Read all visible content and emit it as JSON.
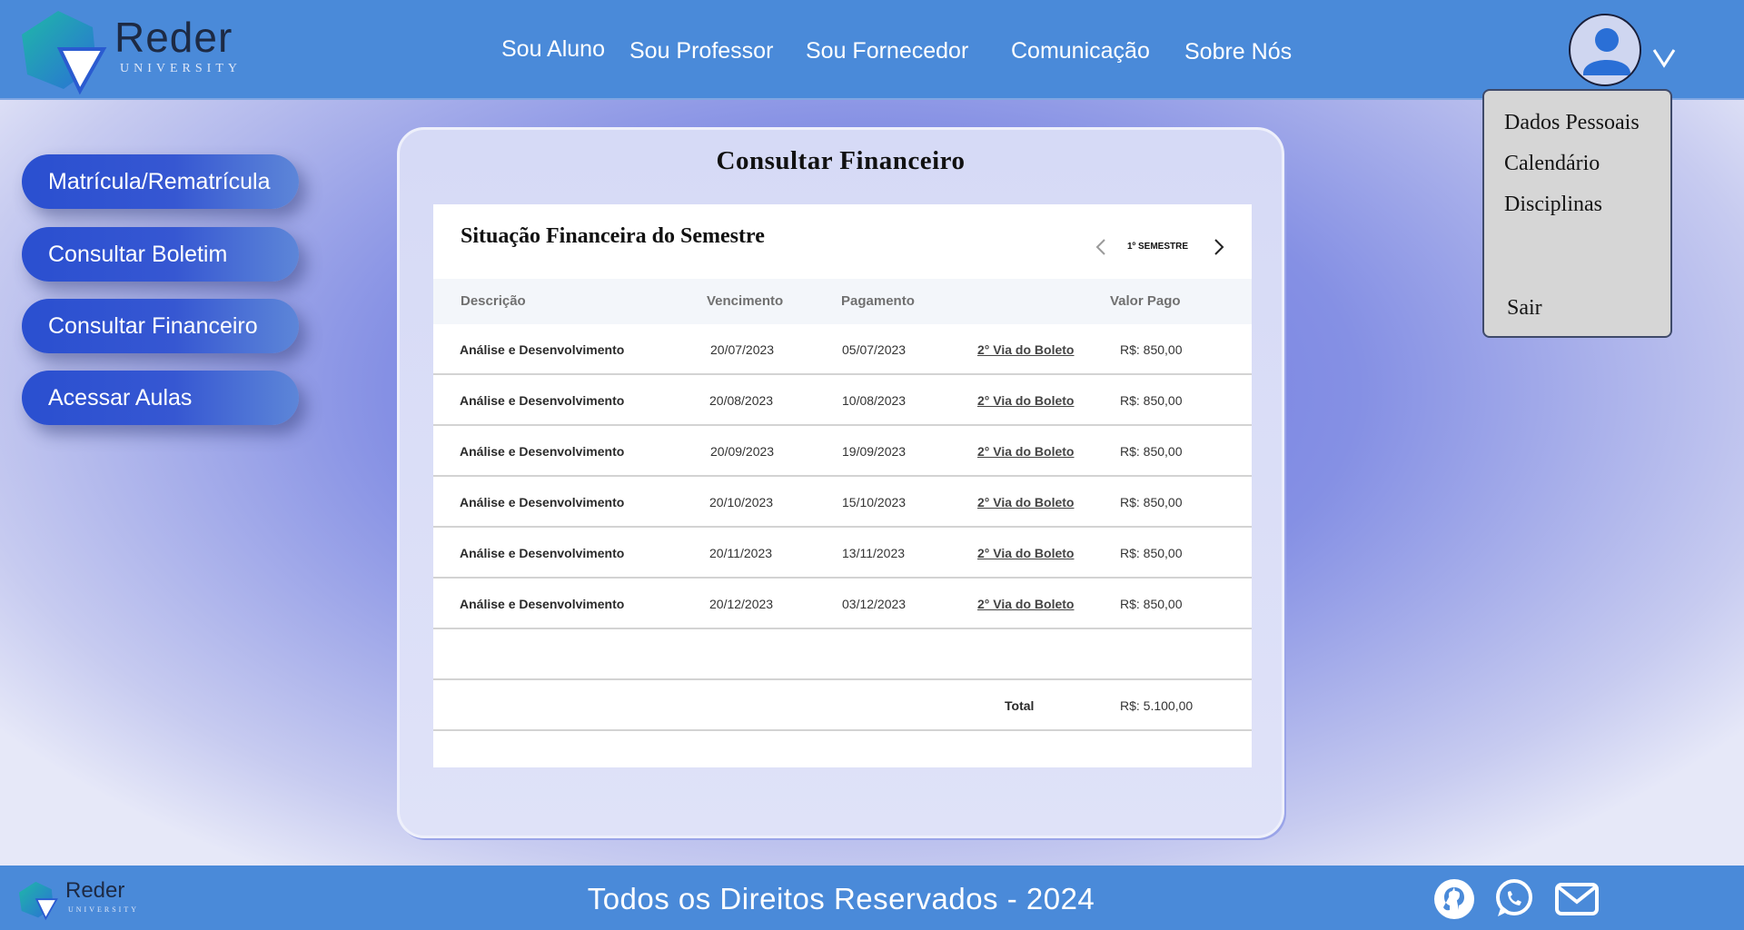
{
  "brand": {
    "name": "Reder",
    "subtitle": "UNIVERSITY"
  },
  "nav": {
    "items": [
      {
        "label": "Sou Aluno"
      },
      {
        "label": "Sou Professor"
      },
      {
        "label": "Sou Fornecedor"
      },
      {
        "label": "Comunicação"
      },
      {
        "label": "Sobre Nós"
      }
    ]
  },
  "user_menu": {
    "items": [
      {
        "label": "Dados Pessoais"
      },
      {
        "label": "Calendário"
      },
      {
        "label": "Disciplinas"
      }
    ],
    "logout_label": "Sair"
  },
  "sidebar": {
    "items": [
      {
        "label": "Matrícula/Rematrícula"
      },
      {
        "label": "Consultar Boletim"
      },
      {
        "label": "Consultar Financeiro"
      },
      {
        "label": "Acessar Aulas"
      }
    ]
  },
  "main": {
    "title": "Consultar Financeiro",
    "card_title": "Situação Financeira do Semestre",
    "semester_label": "1º SEMESTRE",
    "columns": [
      "Descrição",
      "Vencimento",
      "Pagamento",
      "Valor Pago"
    ],
    "rows": [
      {
        "descricao": "Análise e Desenvolvimento",
        "vencimento": "20/07/2023",
        "pagamento": "05/07/2023",
        "boleto": "2° Via do Boleto",
        "valor": "R$: 850,00"
      },
      {
        "descricao": "Análise e Desenvolvimento",
        "vencimento": "20/08/2023",
        "pagamento": "10/08/2023",
        "boleto": "2° Via do Boleto",
        "valor": "R$: 850,00"
      },
      {
        "descricao": "Análise e Desenvolvimento",
        "vencimento": "20/09/2023",
        "pagamento": "19/09/2023",
        "boleto": "2° Via do Boleto",
        "valor": "R$: 850,00"
      },
      {
        "descricao": "Análise e Desenvolvimento",
        "vencimento": "20/10/2023",
        "pagamento": "15/10/2023",
        "boleto": "2° Via do Boleto",
        "valor": "R$: 850,00"
      },
      {
        "descricao": "Análise e Desenvolvimento",
        "vencimento": "20/11/2023",
        "pagamento": "13/11/2023",
        "boleto": "2° Via do Boleto",
        "valor": "R$: 850,00"
      },
      {
        "descricao": "Análise e Desenvolvimento",
        "vencimento": "20/12/2023",
        "pagamento": "03/12/2023",
        "boleto": "2° Via do Boleto",
        "valor": "R$: 850,00"
      }
    ],
    "total_label": "Total",
    "total_value": "R$: 5.100,00"
  },
  "footer": {
    "text": "Todos os Direitos Reservados - 2024"
  },
  "social_icons": [
    "github-icon",
    "whatsapp-icon",
    "mail-icon"
  ],
  "colors": {
    "header_bg": "#4a8ad9",
    "sidebar_button": "#2a4fd0",
    "dropdown_bg": "#d6d6d6"
  }
}
